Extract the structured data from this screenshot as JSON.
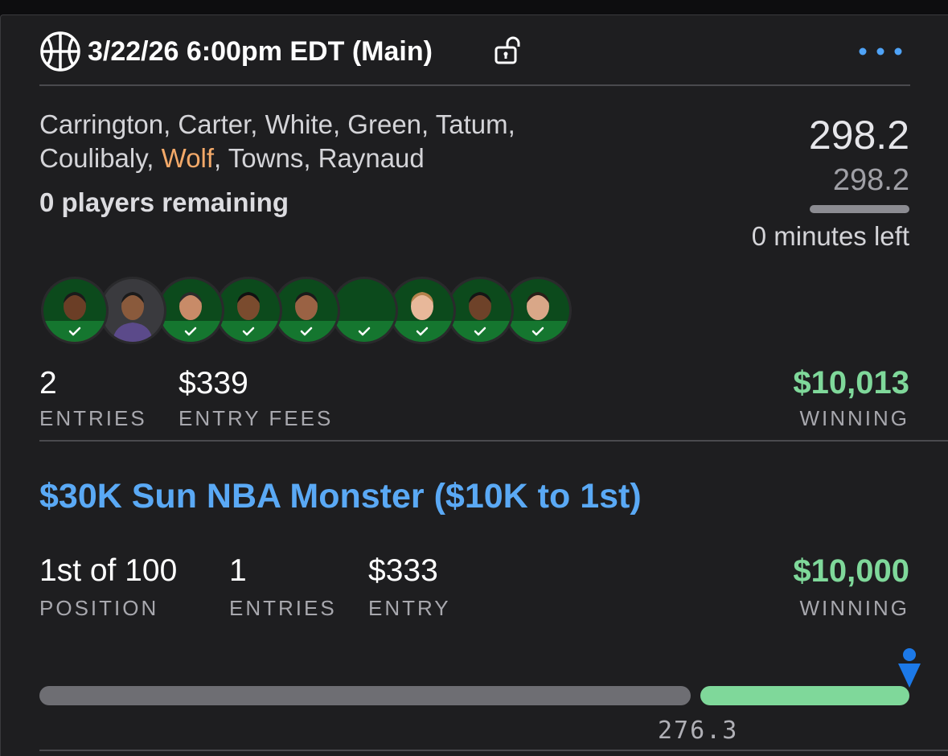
{
  "header": {
    "title": "3/22/26 6:00pm EDT (Main)",
    "sport_icon": "basketball-icon",
    "lock_icon": "unlock-icon",
    "menu_icon": "ellipsis-icon",
    "accent_color": "#4fa3f7"
  },
  "lineup": {
    "players_line1": "Carrington, Carter, White, Green, Tatum,",
    "players_line2_before": "Coulibaly, ",
    "players_line2_highlight": "Wolf",
    "players_line2_after": ", Towns, Raynaud",
    "remaining": "0 players remaining",
    "score": "298.2",
    "projected_score": "298.2",
    "time_left": "0 minutes left",
    "avatars": [
      {
        "name": "avatar-carrington",
        "status": "check-icon"
      },
      {
        "name": "avatar-carter",
        "status": "none"
      },
      {
        "name": "avatar-white",
        "status": "check-icon"
      },
      {
        "name": "avatar-green",
        "status": "check-icon"
      },
      {
        "name": "avatar-tatum",
        "status": "check-icon"
      },
      {
        "name": "avatar-coulibaly",
        "status": "check-icon"
      },
      {
        "name": "avatar-wolf",
        "status": "check-icon"
      },
      {
        "name": "avatar-towns",
        "status": "check-icon"
      },
      {
        "name": "avatar-raynaud",
        "status": "check-icon"
      }
    ]
  },
  "summary": {
    "entries_value": "2",
    "entries_label": "ENTRIES",
    "fees_value": "$339",
    "fees_label": "ENTRY FEES",
    "winning_value": "$10,013",
    "winning_label": "WINNING"
  },
  "contest": {
    "title": "$30K Sun NBA Monster ($10K to 1st)",
    "position_value": "1st of 100",
    "position_label": "POSITION",
    "entries_value": "1",
    "entries_label": "ENTRIES",
    "entry_value": "$333",
    "entry_label": "ENTRY",
    "winning_value": "$10,000",
    "winning_label": "WINNING",
    "progress_marker_icon": "person-marker-icon",
    "progress_cutoff_label": "276.3",
    "paid_fraction": 0.24
  },
  "colors": {
    "background": "#1e1e20",
    "winning_green": "#7fd89a",
    "contest_blue": "#5aa9f5",
    "highlight_orange": "#f3a969",
    "check_green": "#15762f"
  }
}
